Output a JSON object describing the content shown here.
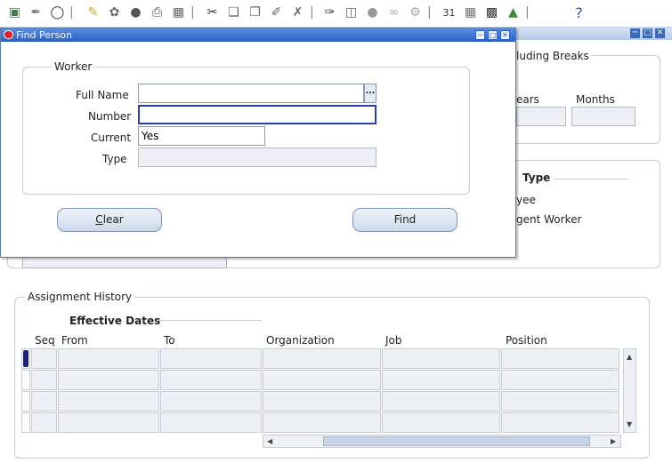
{
  "toolbar": {
    "icons": [
      "new-record-icon",
      "translate-icon",
      "navigate-icon",
      "folder-icon",
      "zoom-icon",
      "tools-icon",
      "print-icon",
      "save-icon",
      "cut-icon",
      "copy-icon",
      "paste-icon",
      "edit-icon",
      "clear-icon",
      "attachments-icon",
      "spell-icon",
      "stop-icon",
      "attach-icon",
      "help-folder-icon",
      "calendar-icon",
      "calendar2-icon",
      "export-icon",
      "upload-icon",
      "help-icon"
    ],
    "help_glyph": "?"
  },
  "background": {
    "group1_legend": "luding Breaks",
    "years_label": "ears",
    "months_label": "Months",
    "type_legend": "Type",
    "type_option1": "yee",
    "type_option2": "gent Worker",
    "assignment_history_legend": "Assignment History",
    "effective_dates_legend": "Effective Dates",
    "columns": [
      "Seq",
      "From",
      "To",
      "Organization",
      "Job",
      "Position"
    ]
  },
  "dialog": {
    "title": "Find Person",
    "worker_legend": "Worker",
    "full_name_label": "Full Name",
    "full_name_value": "",
    "lov_glyph": "...",
    "number_label": "Number",
    "number_value": "",
    "current_label": "Current",
    "current_value": "Yes",
    "type_label": "Type",
    "type_value": "",
    "clear_label_first": "C",
    "clear_label_rest": "lear",
    "find_label": "Find"
  }
}
